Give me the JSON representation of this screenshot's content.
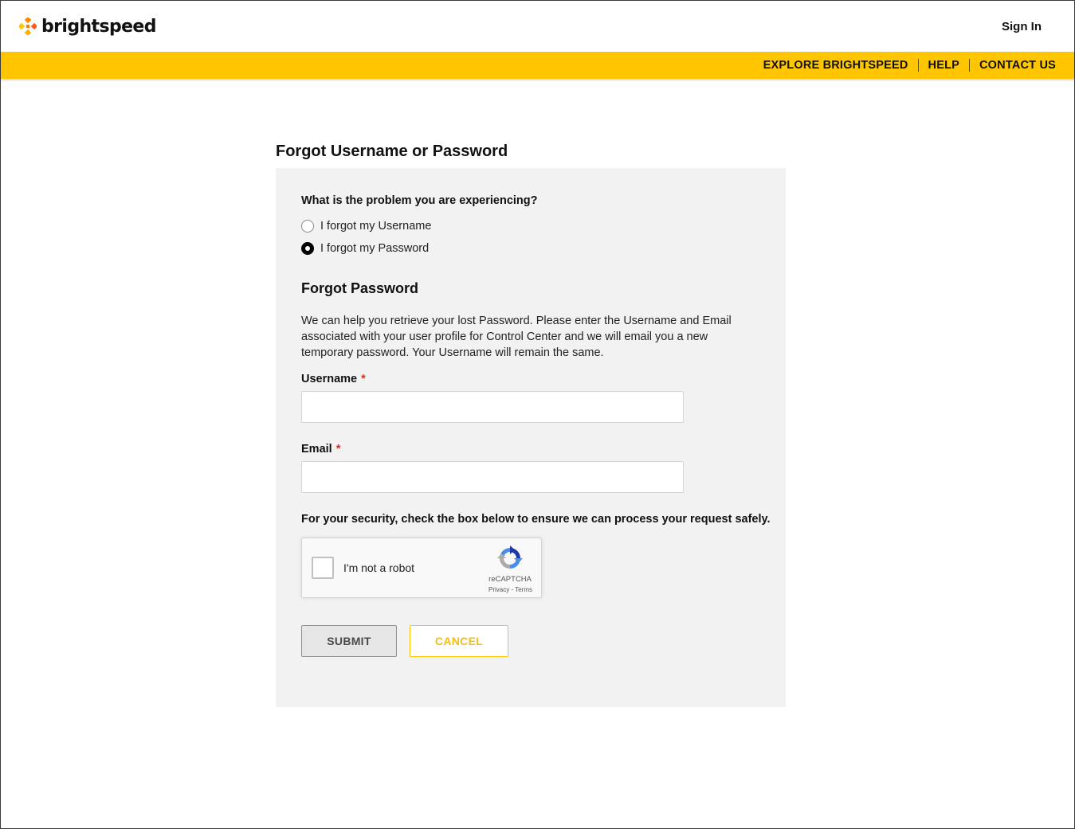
{
  "header": {
    "logo_text": "brightspeed",
    "sign_in": "Sign In"
  },
  "nav": {
    "items": [
      "EXPLORE BRIGHTSPEED",
      "HELP",
      "CONTACT US"
    ]
  },
  "page": {
    "title": "Forgot Username or Password"
  },
  "form": {
    "question": "What is the problem you are experiencing?",
    "options": [
      {
        "label": "I forgot my Username",
        "selected": false
      },
      {
        "label": "I forgot my Password",
        "selected": true
      }
    ],
    "section_title": "Forgot Password",
    "description": "We can help you retrieve your lost Password. Please enter the Username and Email associated with your user profile for Control Center and we will email you a new temporary password. Your Username will remain the same.",
    "username_label": "Username",
    "username_value": "",
    "email_label": "Email",
    "email_value": "",
    "required_mark": "*",
    "security_text": "For your security, check the box below to ensure we can process your request safely.",
    "submit_label": "SUBMIT",
    "cancel_label": "CANCEL"
  },
  "captcha": {
    "label": "I'm not a robot",
    "brand": "reCAPTCHA",
    "links": "Privacy - Terms",
    "checked": false
  },
  "colors": {
    "brand_yellow": "#ffc600",
    "panel_bg": "#f2f2f2",
    "required": "#c0392b"
  },
  "icons": {
    "logo": "brightspeed-logo-icon",
    "captcha": "recaptcha-icon"
  }
}
